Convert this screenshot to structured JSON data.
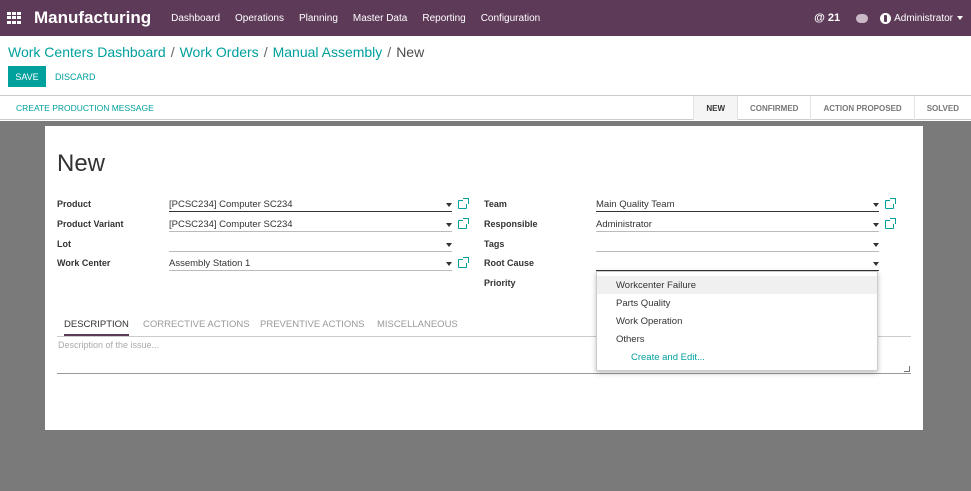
{
  "navbar": {
    "app_title": "Manufacturing",
    "menu": [
      "Dashboard",
      "Operations",
      "Planning",
      "Master Data",
      "Reporting",
      "Configuration"
    ],
    "mentions": "@ 21",
    "user": "Administrator",
    "background": "#5e3a59"
  },
  "breadcrumb": {
    "items": [
      "Work Centers Dashboard",
      "Work Orders",
      "Manual Assembly"
    ],
    "current": "New"
  },
  "buttons": {
    "save": "SAVE",
    "discard": "DISCARD"
  },
  "statusbar": {
    "action": "CREATE PRODUCTION MESSAGE",
    "stages": [
      "NEW",
      "CONFIRMED",
      "ACTION PROPOSED",
      "SOLVED"
    ],
    "current_stage": "NEW"
  },
  "form": {
    "title": "New",
    "left": [
      {
        "label": "Product",
        "value": "[PCSC234] Computer SC234"
      },
      {
        "label": "Product Variant",
        "value": "[PCSC234] Computer SC234"
      },
      {
        "label": "Lot",
        "value": ""
      },
      {
        "label": "Work Center",
        "value": "Assembly Station 1"
      }
    ],
    "right": [
      {
        "label": "Team",
        "value": "Main Quality Team"
      },
      {
        "label": "Responsible",
        "value": "Administrator"
      },
      {
        "label": "Tags",
        "value": ""
      },
      {
        "label": "Root Cause",
        "value": ""
      },
      {
        "label": "Priority",
        "value": ""
      }
    ]
  },
  "notebook": {
    "tabs": [
      "DESCRIPTION",
      "CORRECTIVE ACTIONS",
      "PREVENTIVE ACTIONS",
      "MISCELLANEOUS"
    ],
    "active_tab": "DESCRIPTION",
    "description_placeholder": "Description of the issue..."
  },
  "root_cause_dropdown": {
    "options": [
      "Workcenter Failure",
      "Parts Quality",
      "Work Operation",
      "Others"
    ],
    "highlighted": "Workcenter Failure",
    "create_and_edit": "Create and Edit..."
  },
  "colors": {
    "accent": "#00a09d",
    "navbar": "#5e3a59",
    "backdrop": "#7a7a7a"
  }
}
